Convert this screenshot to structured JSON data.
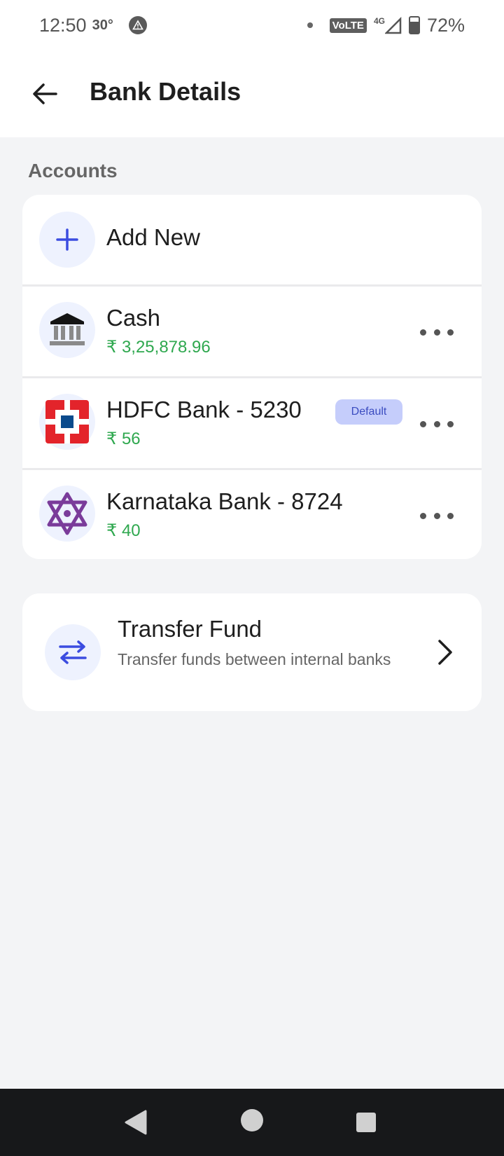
{
  "status_bar": {
    "time": "12:50",
    "temperature": "30°",
    "network_badge": "VoLTE",
    "network_type": "4G",
    "battery": "72%",
    "battery_level": 0.72
  },
  "header": {
    "title": "Bank Details",
    "back_icon": "arrow-left-icon"
  },
  "accounts": {
    "section_label": "Accounts",
    "add_new_label": "Add New",
    "items": [
      {
        "name": "Cash",
        "amount": "₹ 3,25,878.96",
        "icon": "bank-building-icon",
        "default": false
      },
      {
        "name": "HDFC Bank - 5230",
        "amount": "₹ 56",
        "icon": "hdfc-logo-icon",
        "default": true,
        "badge": "Default"
      },
      {
        "name": "Karnataka Bank - 8724",
        "amount": "₹ 40",
        "icon": "karnataka-bank-logo-icon",
        "default": false
      }
    ]
  },
  "transfer": {
    "title": "Transfer Fund",
    "description": "Transfer funds between internal banks",
    "icon": "swap-arrows-icon"
  },
  "colors": {
    "accent": "#3b4ce0",
    "amount_green": "#2fa84f",
    "badge_bg": "#c5cdfb",
    "background": "#f3f4f6",
    "nav_bar": "#17181a"
  }
}
